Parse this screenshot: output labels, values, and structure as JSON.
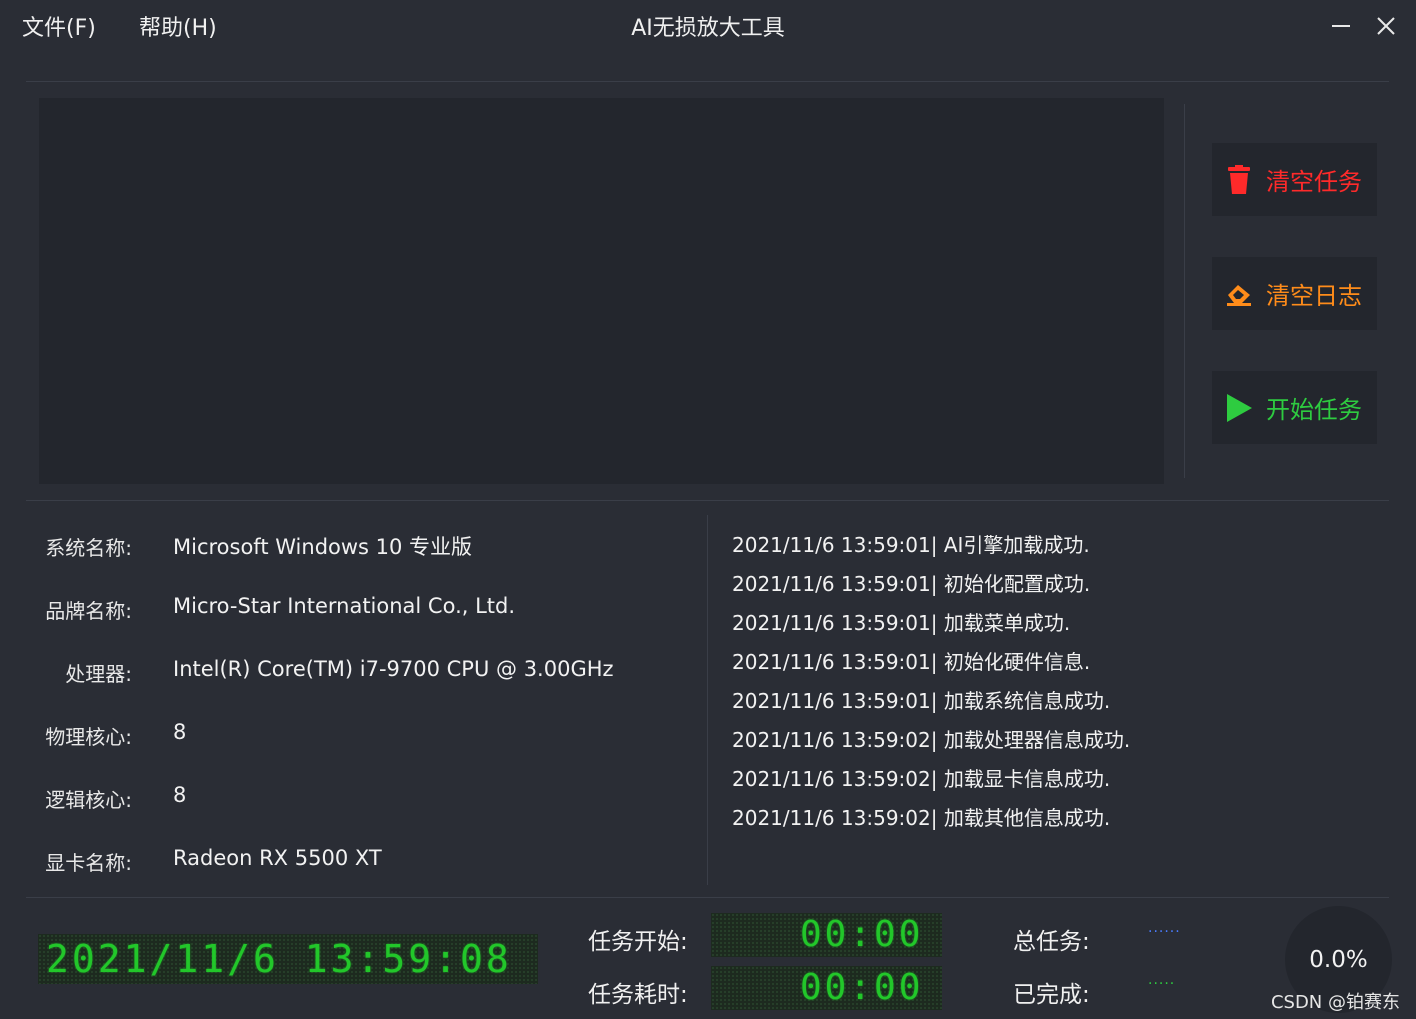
{
  "menu": {
    "file": "文件(F)",
    "help": "帮助(H)"
  },
  "app_title": "AI无损放大工具",
  "actions": {
    "clear_tasks": {
      "label": "清空任务",
      "color": "#ff2a2a",
      "icon": "trash-icon"
    },
    "clear_log": {
      "label": "清空日志",
      "color": "#ff8c1a",
      "icon": "eraser-icon"
    },
    "start_task": {
      "label": "开始任务",
      "color": "#2ecc40",
      "icon": "play-icon"
    }
  },
  "info": {
    "os": {
      "label": "系统名称:",
      "value": "Microsoft Windows 10 专业版"
    },
    "brand": {
      "label": "品牌名称:",
      "value": "Micro-Star International Co., Ltd."
    },
    "cpu": {
      "label": "处理器:",
      "value": "Intel(R) Core(TM) i7-9700 CPU @ 3.00GHz"
    },
    "physical": {
      "label": "物理核心:",
      "value": "8"
    },
    "logical": {
      "label": "逻辑核心:",
      "value": "8"
    },
    "gpu": {
      "label": "显卡名称:",
      "value": "Radeon RX 5500 XT"
    }
  },
  "log": [
    "2021/11/6 13:59:01| AI引擎加载成功.",
    "2021/11/6 13:59:01| 初始化配置成功.",
    "2021/11/6 13:59:01| 加载菜单成功.",
    "2021/11/6 13:59:01| 初始化硬件信息.",
    "2021/11/6 13:59:01| 加载系统信息成功.",
    "2021/11/6 13:59:02| 加载处理器信息成功.",
    "2021/11/6 13:59:02| 加载显卡信息成功.",
    "2021/11/6 13:59:02| 加载其他信息成功."
  ],
  "status": {
    "clock": "2021/11/6 13:59:08",
    "task_start_label": "任务开始:",
    "task_start_value": "00:00",
    "task_elapsed_label": "任务耗时:",
    "task_elapsed_value": "00:00",
    "total_label": "总任务:",
    "total_value": "······",
    "done_label": "已完成:",
    "done_value": "·····",
    "progress_percent": "0.0%"
  },
  "watermark": "CSDN @铂赛东",
  "colors": {
    "background": "#2a2d35",
    "panel": "#23262d",
    "lcd_green": "#22c72a",
    "dots_blue": "#4a7cff",
    "dots_green": "#2ecc40"
  }
}
